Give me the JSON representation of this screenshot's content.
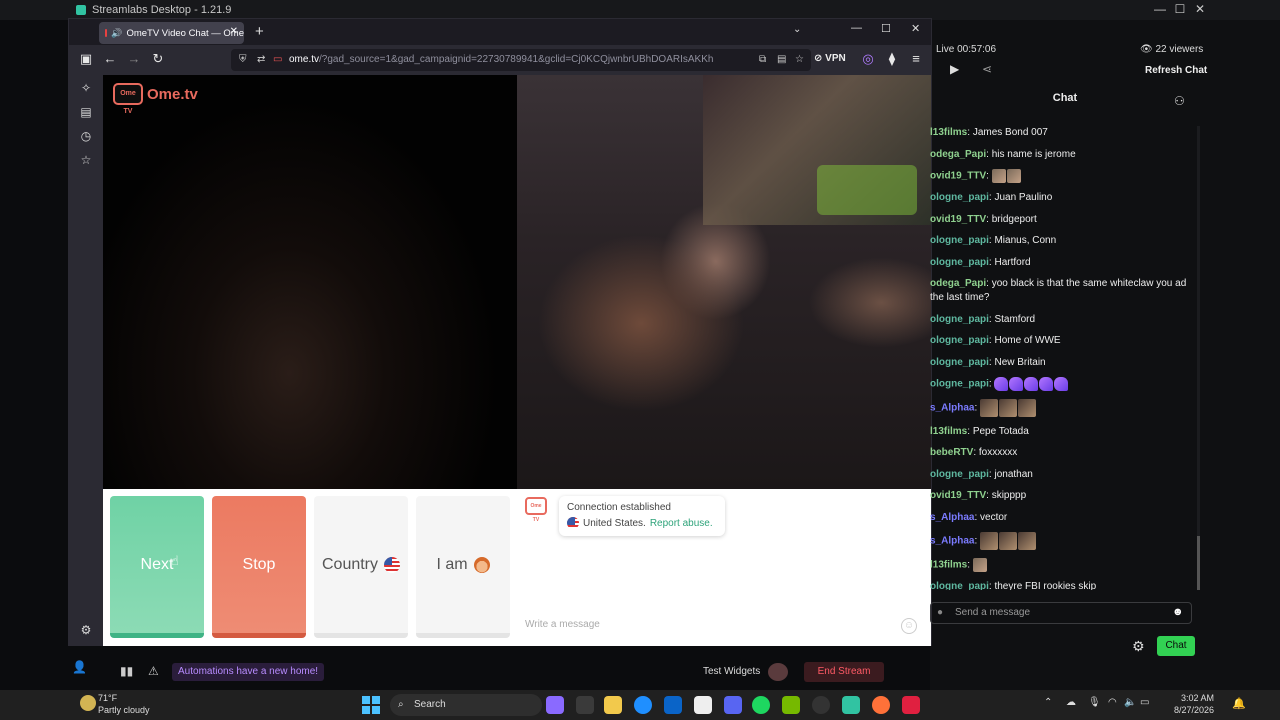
{
  "app": {
    "title": "Streamlabs Desktop - 1.21.9"
  },
  "browser": {
    "tab_title": "OmeTV Video Chat — Ome",
    "url_main": "ome.tv",
    "url_rest": "/?gad_source=1&gad_campaignid=22730789941&gclid=Cj0KCQjwnbrUBhDOARIsAKKh",
    "vpn_label": "VPN"
  },
  "ometv": {
    "logo_box": "Ome TV",
    "logo_text": "Ome.tv",
    "buttons": {
      "next": "Next",
      "stop": "Stop",
      "country": "Country",
      "iam": "I am"
    },
    "chat": {
      "status": "Connection established",
      "country": "United States.",
      "report": "Report abuse.",
      "placeholder": "Write a message"
    }
  },
  "stream": {
    "live_time": "Live 00:57:06",
    "viewers": "22 viewers",
    "refresh": "Refresh Chat",
    "chat_title": "Chat",
    "send_placeholder": "Send a message",
    "chat_button": "Chat",
    "notification": "Automations have a new home!",
    "test_widgets": "Test Widgets",
    "end_stream": "End Stream"
  },
  "chat_messages": [
    {
      "user": "l13films",
      "color": "#8fd18f",
      "text": "James Bond 007",
      "emotes": []
    },
    {
      "user": "odega_Papi",
      "color": "#8fd18f",
      "text": "his name is jerome",
      "emotes": []
    },
    {
      "user": "ovid19_TTV",
      "color": "#8fd18f",
      "text": "",
      "emotes": [
        "face",
        "face"
      ]
    },
    {
      "user": "ologne_papi",
      "color": "#5fb8a0",
      "text": "Juan Paulino",
      "emotes": []
    },
    {
      "user": "ovid19_TTV",
      "color": "#8fd18f",
      "text": "bridgeport",
      "emotes": []
    },
    {
      "user": "ologne_papi",
      "color": "#5fb8a0",
      "text": "Mianus, Conn",
      "emotes": []
    },
    {
      "user": "ologne_papi",
      "color": "#5fb8a0",
      "text": "Hartford",
      "emotes": []
    },
    {
      "user": "odega_Papi",
      "color": "#8fd18f",
      "text": "yoo black is that the same whiteclaw you ad the last time?",
      "emotes": []
    },
    {
      "user": "ologne_papi",
      "color": "#5fb8a0",
      "text": "Stamford",
      "emotes": []
    },
    {
      "user": "ologne_papi",
      "color": "#5fb8a0",
      "text": "Home of WWE",
      "emotes": []
    },
    {
      "user": "ologne_papi",
      "color": "#5fb8a0",
      "text": "New Britain",
      "emotes": []
    },
    {
      "user": "ologne_papi",
      "color": "#5fb8a0",
      "text": "",
      "emotes": [
        "purple",
        "purple",
        "purple",
        "purple",
        "purple"
      ]
    },
    {
      "user": "s_Alphaa",
      "color": "#7b7bff",
      "text": "",
      "emotes": [
        "face2",
        "face2",
        "face2"
      ]
    },
    {
      "user": "l13films",
      "color": "#8fd18f",
      "text": "Pepe Totada",
      "emotes": []
    },
    {
      "user": "bebeRTV",
      "color": "#8fd18f",
      "text": "foxxxxxx",
      "emotes": []
    },
    {
      "user": "ologne_papi",
      "color": "#5fb8a0",
      "text": "jonathan",
      "emotes": []
    },
    {
      "user": "ovid19_TTV",
      "color": "#8fd18f",
      "text": "skipppp",
      "emotes": []
    },
    {
      "user": "s_Alphaa",
      "color": "#7b7bff",
      "text": "vector",
      "emotes": []
    },
    {
      "user": "s_Alphaa",
      "color": "#7b7bff",
      "text": "",
      "emotes": [
        "face2",
        "face2",
        "face2"
      ]
    },
    {
      "user": "l13films",
      "color": "#8fd18f",
      "text": "",
      "emotes": [
        "face"
      ]
    },
    {
      "user": "ologne_papi",
      "color": "#5fb8a0",
      "text": "theyre FBI rookies skip",
      "emotes": []
    }
  ],
  "taskbar": {
    "temp": "71°F",
    "weather": "Partly cloudy",
    "search": "Search",
    "time": "3:02 AM",
    "date": "8/27/2026"
  }
}
